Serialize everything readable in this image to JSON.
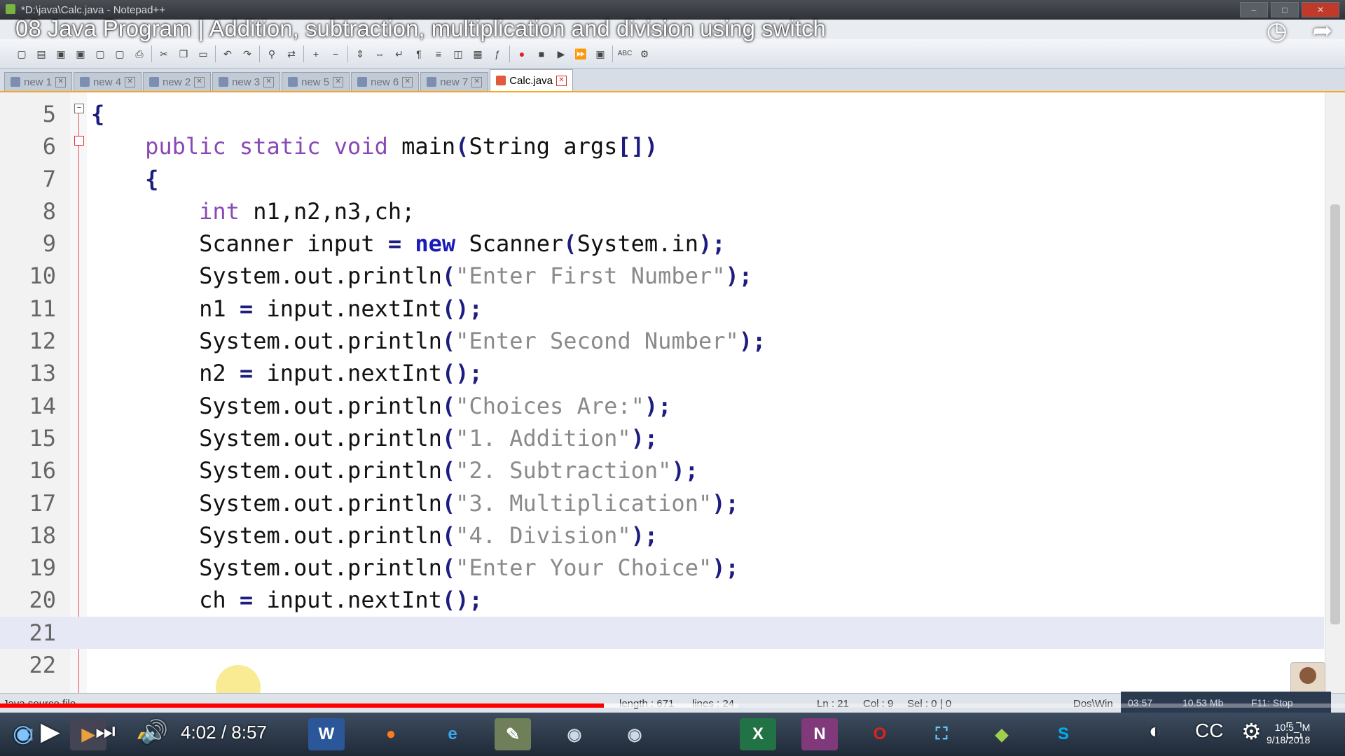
{
  "window": {
    "title": "*D:\\java\\Calc.java - Notepad++",
    "buttons": [
      "–",
      "□",
      "✕"
    ]
  },
  "video": {
    "title": "08 Java Program | Addition, subtraction, multiplication and division using switch",
    "watch_later_icon": "clock-icon",
    "share_icon": "share-arrow-icon",
    "current_time": "4:02",
    "duration": "8:57",
    "time_display": "4:02 / 8:57",
    "progress_fraction": 0.449
  },
  "tabs": [
    {
      "label": "new  1"
    },
    {
      "label": "new  4"
    },
    {
      "label": "new  2"
    },
    {
      "label": "new  3"
    },
    {
      "label": "new  5"
    },
    {
      "label": "new  6"
    },
    {
      "label": "new  7"
    },
    {
      "label": "Calc.java",
      "active": true
    }
  ],
  "editor": {
    "lines": [
      {
        "num": "5",
        "segments": [
          {
            "t": "{",
            "c": "op"
          }
        ]
      },
      {
        "num": "6",
        "segments": [
          {
            "t": "    public static void ",
            "c": "kw"
          },
          {
            "t": "main",
            "c": ""
          },
          {
            "t": "(",
            "c": "op"
          },
          {
            "t": "String args",
            "c": ""
          },
          {
            "t": "[])",
            "c": "op"
          }
        ]
      },
      {
        "num": "7",
        "segments": [
          {
            "t": "    {",
            "c": "op"
          }
        ]
      },
      {
        "num": "8",
        "segments": [
          {
            "t": "        int ",
            "c": "kw"
          },
          {
            "t": "n1,n2,n3,ch;",
            "c": ""
          }
        ]
      },
      {
        "num": "9",
        "segments": [
          {
            "t": "        Scanner input ",
            "c": ""
          },
          {
            "t": "= ",
            "c": "op"
          },
          {
            "t": "new ",
            "c": "kw2"
          },
          {
            "t": "Scanner",
            "c": ""
          },
          {
            "t": "(",
            "c": "op"
          },
          {
            "t": "System.in",
            "c": ""
          },
          {
            "t": ");",
            "c": "op"
          }
        ]
      },
      {
        "num": "10",
        "segments": [
          {
            "t": "        System.out.println",
            "c": ""
          },
          {
            "t": "(",
            "c": "op"
          },
          {
            "t": "\"Enter First Number\"",
            "c": "str"
          },
          {
            "t": ");",
            "c": "op"
          }
        ]
      },
      {
        "num": "11",
        "segments": [
          {
            "t": "        n1 ",
            "c": ""
          },
          {
            "t": "= ",
            "c": "op"
          },
          {
            "t": "input.nextInt",
            "c": ""
          },
          {
            "t": "();",
            "c": "op"
          }
        ]
      },
      {
        "num": "12",
        "segments": [
          {
            "t": "        System.out.println",
            "c": ""
          },
          {
            "t": "(",
            "c": "op"
          },
          {
            "t": "\"Enter Second Number\"",
            "c": "str"
          },
          {
            "t": ");",
            "c": "op"
          }
        ]
      },
      {
        "num": "13",
        "segments": [
          {
            "t": "        n2 ",
            "c": ""
          },
          {
            "t": "= ",
            "c": "op"
          },
          {
            "t": "input.nextInt",
            "c": ""
          },
          {
            "t": "();",
            "c": "op"
          }
        ]
      },
      {
        "num": "14",
        "segments": [
          {
            "t": "        System.out.println",
            "c": ""
          },
          {
            "t": "(",
            "c": "op"
          },
          {
            "t": "\"Choices Are:\"",
            "c": "str"
          },
          {
            "t": ");",
            "c": "op"
          }
        ]
      },
      {
        "num": "15",
        "segments": [
          {
            "t": "        System.out.println",
            "c": ""
          },
          {
            "t": "(",
            "c": "op"
          },
          {
            "t": "\"1. Addition\"",
            "c": "str"
          },
          {
            "t": ");",
            "c": "op"
          }
        ]
      },
      {
        "num": "16",
        "segments": [
          {
            "t": "        System.out.println",
            "c": ""
          },
          {
            "t": "(",
            "c": "op"
          },
          {
            "t": "\"2. Subtraction\"",
            "c": "str"
          },
          {
            "t": ");",
            "c": "op"
          }
        ]
      },
      {
        "num": "17",
        "segments": [
          {
            "t": "        System.out.println",
            "c": ""
          },
          {
            "t": "(",
            "c": "op"
          },
          {
            "t": "\"3. Multiplication\"",
            "c": "str"
          },
          {
            "t": ");",
            "c": "op"
          }
        ]
      },
      {
        "num": "18",
        "segments": [
          {
            "t": "        System.out.println",
            "c": ""
          },
          {
            "t": "(",
            "c": "op"
          },
          {
            "t": "\"4. Division\"",
            "c": "str"
          },
          {
            "t": ");",
            "c": "op"
          }
        ]
      },
      {
        "num": "19",
        "segments": [
          {
            "t": "        System.out.println",
            "c": ""
          },
          {
            "t": "(",
            "c": "op"
          },
          {
            "t": "\"Enter Your Choice\"",
            "c": "str"
          },
          {
            "t": ");",
            "c": "op"
          }
        ]
      },
      {
        "num": "20",
        "segments": [
          {
            "t": "        ch ",
            "c": ""
          },
          {
            "t": "= ",
            "c": "op"
          },
          {
            "t": "input.nextInt",
            "c": ""
          },
          {
            "t": "();",
            "c": "op"
          }
        ]
      },
      {
        "num": "21",
        "segments": [],
        "current": true
      },
      {
        "num": "22",
        "segments": []
      }
    ]
  },
  "statusbar": {
    "file_type": "Java source file",
    "length": "length : 671",
    "lines": "lines : 24",
    "ln": "Ln : 21",
    "col": "Col : 9",
    "sel": "Sel : 0 | 0",
    "eol": "Dos\\Win"
  },
  "recorder": {
    "time": "03:57",
    "size": "10.53 Mb",
    "stop": "F11: Stop"
  },
  "clock": {
    "time": "10:5_ M",
    "date": "9/18/2018"
  },
  "taskbar": {
    "icons": [
      "windows-start-icon",
      "media-player-icon",
      "file-explorer-icon",
      "word-icon",
      "firefox-icon",
      "internet-explorer-icon",
      "notepadpp-icon",
      "media-icon-1",
      "media-icon-2",
      "excel-icon",
      "onenote-icon",
      "opera-icon",
      "screen-capture-icon",
      "layers-icon",
      "skype-icon"
    ]
  }
}
